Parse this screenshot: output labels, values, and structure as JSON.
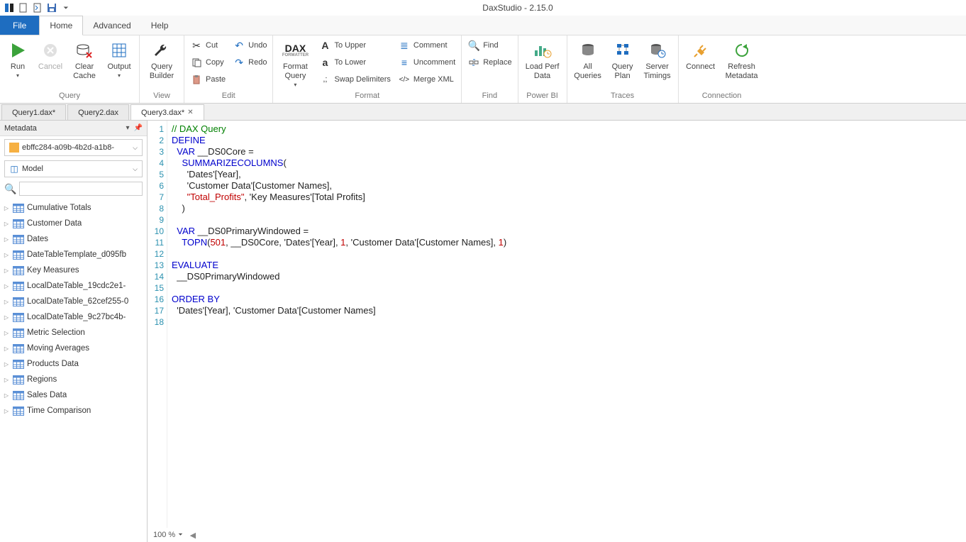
{
  "app_title": "DaxStudio - 2.15.0",
  "menus": {
    "file": "File",
    "home": "Home",
    "advanced": "Advanced",
    "help": "Help"
  },
  "ribbon": {
    "groups": {
      "query": {
        "label": "Query",
        "run": "Run",
        "cancel": "Cancel",
        "clear_cache": "Clear\nCache",
        "output": "Output"
      },
      "view": {
        "label": "View",
        "query_builder": "Query\nBuilder"
      },
      "edit": {
        "label": "Edit",
        "cut": "Cut",
        "copy": "Copy",
        "paste": "Paste",
        "undo": "Undo",
        "redo": "Redo"
      },
      "format": {
        "label": "Format",
        "format_query": "Format\nQuery",
        "to_upper": "To Upper",
        "to_lower": "To Lower",
        "swap_delim": "Swap Delimiters",
        "comment": "Comment",
        "uncomment": "Uncomment",
        "merge_xml": "Merge XML"
      },
      "find": {
        "label": "Find",
        "find": "Find",
        "replace": "Replace"
      },
      "powerbi": {
        "label": "Power BI",
        "load_perf": "Load Perf\nData"
      },
      "traces": {
        "label": "Traces",
        "all_queries": "All\nQueries",
        "query_plan": "Query\nPlan",
        "server_timings": "Server\nTimings"
      },
      "connection": {
        "label": "Connection",
        "connect": "Connect",
        "refresh_metadata": "Refresh\nMetadata"
      }
    }
  },
  "doc_tabs": [
    {
      "label": "Query1.dax*",
      "active": false
    },
    {
      "label": "Query2.dax",
      "active": false
    },
    {
      "label": "Query3.dax*",
      "active": true
    }
  ],
  "metadata": {
    "panel_title": "Metadata",
    "database": "ebffc284-a09b-4b2d-a1b8-",
    "model": "Model",
    "search_placeholder": "",
    "tables": [
      "Cumulative Totals",
      "Customer Data",
      "Dates",
      "DateTableTemplate_d095fb",
      "Key Measures",
      "LocalDateTable_19cdc2e1-",
      "LocalDateTable_62cef255-0",
      "LocalDateTable_9c27bc4b-",
      "Metric Selection",
      "Moving Averages",
      "Products Data",
      "Regions",
      "Sales Data",
      "Time Comparison"
    ]
  },
  "code_lines": [
    {
      "n": 1,
      "tokens": [
        {
          "t": "// DAX Query",
          "c": "comment"
        }
      ]
    },
    {
      "n": 2,
      "tokens": [
        {
          "t": "DEFINE",
          "c": "keyword"
        }
      ]
    },
    {
      "n": 3,
      "tokens": [
        {
          "t": "  ",
          "c": "text"
        },
        {
          "t": "VAR",
          "c": "keyword"
        },
        {
          "t": " __DS0Core =",
          "c": "text"
        }
      ]
    },
    {
      "n": 4,
      "tokens": [
        {
          "t": "    ",
          "c": "text"
        },
        {
          "t": "SUMMARIZECOLUMNS",
          "c": "func"
        },
        {
          "t": "(",
          "c": "text"
        }
      ]
    },
    {
      "n": 5,
      "tokens": [
        {
          "t": "      'Dates'[Year],",
          "c": "text"
        }
      ]
    },
    {
      "n": 6,
      "tokens": [
        {
          "t": "      'Customer Data'[Customer Names],",
          "c": "text"
        }
      ]
    },
    {
      "n": 7,
      "tokens": [
        {
          "t": "      ",
          "c": "text"
        },
        {
          "t": "\"Total_Profits\"",
          "c": "string"
        },
        {
          "t": ", 'Key Measures'[Total Profits]",
          "c": "text"
        }
      ]
    },
    {
      "n": 8,
      "tokens": [
        {
          "t": "    )",
          "c": "text"
        }
      ]
    },
    {
      "n": 9,
      "tokens": [
        {
          "t": "",
          "c": "text"
        }
      ]
    },
    {
      "n": 10,
      "tokens": [
        {
          "t": "  ",
          "c": "text"
        },
        {
          "t": "VAR",
          "c": "keyword"
        },
        {
          "t": " __DS0PrimaryWindowed =",
          "c": "text"
        }
      ]
    },
    {
      "n": 11,
      "tokens": [
        {
          "t": "    ",
          "c": "text"
        },
        {
          "t": "TOPN",
          "c": "func"
        },
        {
          "t": "(",
          "c": "text"
        },
        {
          "t": "501",
          "c": "number"
        },
        {
          "t": ", __DS0Core, 'Dates'[Year], ",
          "c": "text"
        },
        {
          "t": "1",
          "c": "number"
        },
        {
          "t": ", 'Customer Data'[Customer Names], ",
          "c": "text"
        },
        {
          "t": "1",
          "c": "number"
        },
        {
          "t": ")",
          "c": "text"
        }
      ]
    },
    {
      "n": 12,
      "tokens": [
        {
          "t": "",
          "c": "text"
        }
      ]
    },
    {
      "n": 13,
      "tokens": [
        {
          "t": "EVALUATE",
          "c": "keyword"
        }
      ]
    },
    {
      "n": 14,
      "tokens": [
        {
          "t": "  __DS0PrimaryWindowed",
          "c": "text"
        }
      ]
    },
    {
      "n": 15,
      "tokens": [
        {
          "t": "",
          "c": "text"
        }
      ]
    },
    {
      "n": 16,
      "tokens": [
        {
          "t": "ORDER BY",
          "c": "keyword"
        }
      ]
    },
    {
      "n": 17,
      "tokens": [
        {
          "t": "  'Dates'[Year], 'Customer Data'[Customer Names]",
          "c": "text"
        }
      ]
    },
    {
      "n": 18,
      "tokens": [
        {
          "t": "",
          "c": "text"
        }
      ]
    }
  ],
  "zoom": "100 %"
}
